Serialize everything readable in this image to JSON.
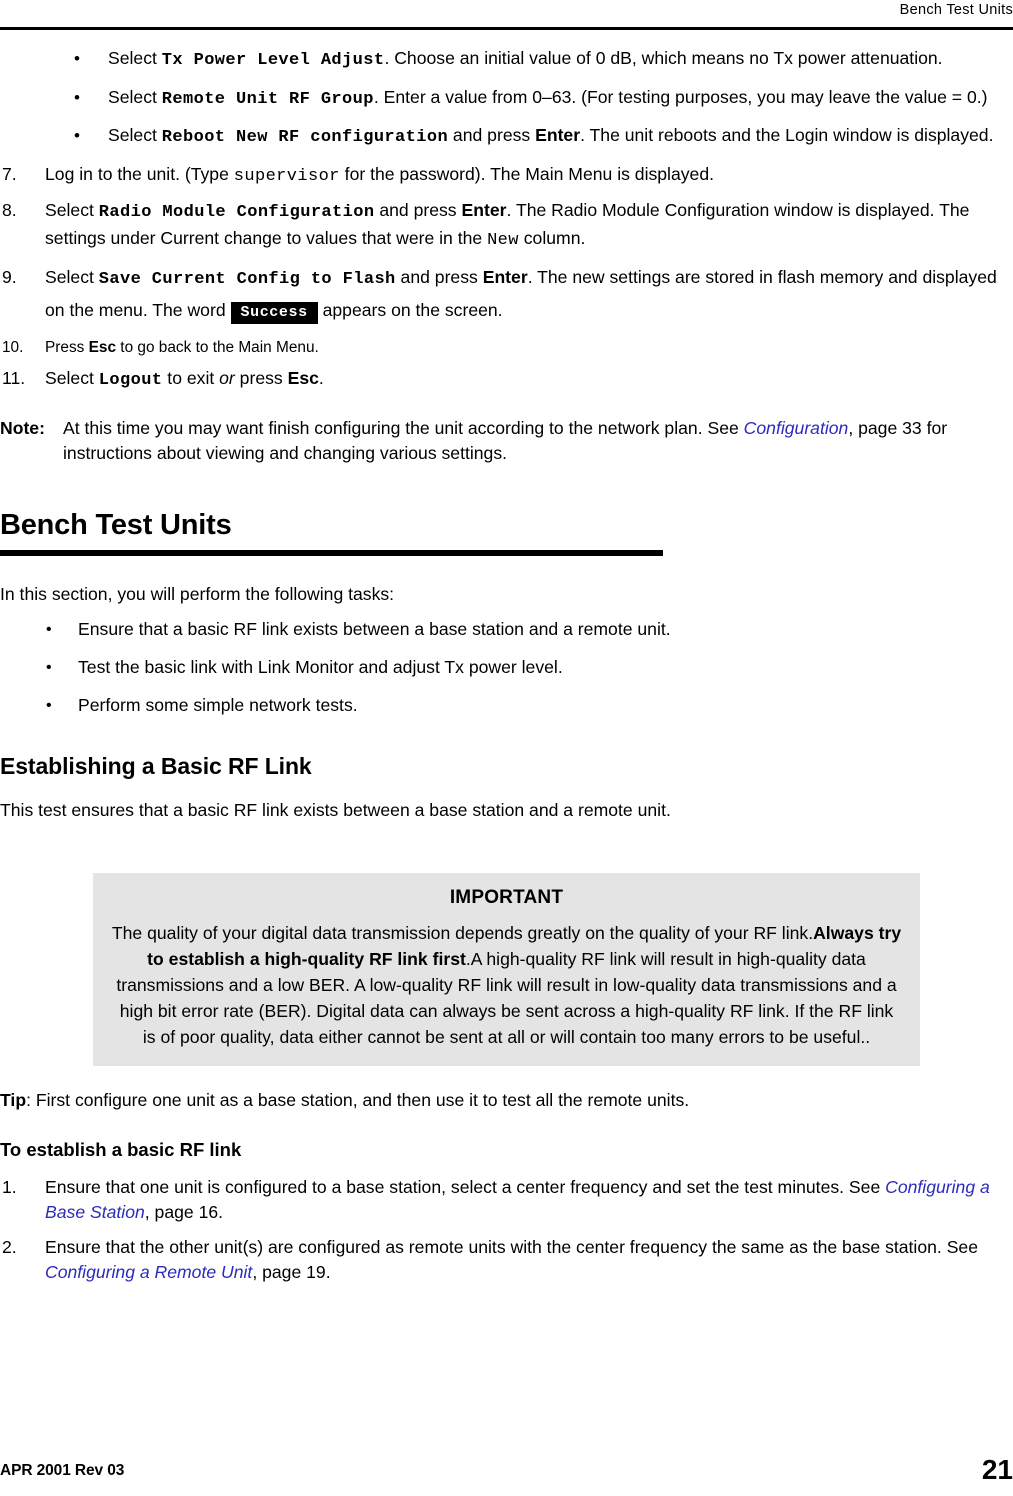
{
  "header": {
    "title": "Bench Test Units"
  },
  "sub_bullets": [
    {
      "bullet": "•",
      "lead": "Select ",
      "code": "Tx Power Level Adjust",
      "rest": ". Choose an initial value of 0 dB, which means no Tx power attenuation."
    },
    {
      "bullet": "•",
      "lead": "Select ",
      "code": "Remote Unit RF Group",
      "rest": ". Enter a value from 0–63. (For testing purposes, you may leave the value = 0.)"
    },
    {
      "bullet": "•",
      "lead": "Select ",
      "code": "Reboot New RF configuration",
      "mid": " and press ",
      "key": "Enter",
      "rest": ". The unit reboots and the Login window is displayed."
    }
  ],
  "steps": {
    "step7": {
      "num": "7.",
      "a": "Log in to the unit. (Type ",
      "mono": "supervisor",
      "b": " for the password). The Main Menu is displayed."
    },
    "step8": {
      "num": "8.",
      "a": "Select ",
      "code": "Radio Module Configuration",
      "b": " and press ",
      "key": "Enter",
      "c": ". The Radio Module Configuration window is displayed. The settings under Current change to values that were in the ",
      "mono": "New",
      "d": " column."
    },
    "step9": {
      "num": "9.",
      "a": "Select ",
      "code": "Save Current Config to Flash",
      "b": " and press ",
      "key": "Enter",
      "c": ". The new settings are stored in flash memory and displayed on the menu. The word ",
      "badge": "Success",
      "d": " appears on the screen."
    },
    "step10": {
      "num": "10.",
      "a": "Press ",
      "key": "Esc",
      "b": " to go back to the Main Menu."
    },
    "step11": {
      "num": "11.",
      "a": "Select ",
      "code": "Logout",
      "b": " to exit ",
      "em": "or",
      "c": " press ",
      "key": "Esc",
      "d": "."
    }
  },
  "note": {
    "label": "Note:",
    "a": "At this time you may want finish configuring the unit according to the network plan. See ",
    "xref": "Configuration",
    "b": ", page 33 for instructions about viewing and changing various settings."
  },
  "section": {
    "heading": "Bench Test Units",
    "intro": "In this section, you will perform the following tasks:",
    "tasks": [
      "Ensure that a basic RF link exists between a base station and a remote unit.",
      "Test the basic link with Link Monitor and adjust Tx power level.",
      "Perform some simple network tests."
    ]
  },
  "subsection": {
    "heading": "Establishing a Basic RF Link",
    "intro": "This test ensures that a basic RF link exists between a base station and a remote unit."
  },
  "callout": {
    "title": "IMPORTANT",
    "a": "The quality of your digital data transmission depends greatly on the quality of your RF link.",
    "bold": "Always try to establish a high-quality RF link first",
    "b": ".A high-quality RF link will result in high-quality data transmissions and a low BER. A low-quality RF link will result in low-quality data transmissions and a high bit error rate (BER). Digital data can always be sent across a high-quality RF link. If the RF link is of poor quality, data either cannot be sent at all or will contain too many errors to be useful.."
  },
  "tip": {
    "label": "Tip",
    "text": ": First configure one unit as a base station, and then use it to test all the remote units."
  },
  "procedure": {
    "heading": "To establish a basic RF link",
    "step1": {
      "num": "1.",
      "a": "Ensure that one unit is configured to a base station, select a center frequency and set the test minutes. See ",
      "xref": "Configuring a Base Station",
      "b": ", page 16."
    },
    "step2": {
      "num": "2.",
      "a": "Ensure that the other unit(s) are configured as remote units with the center frequency the same as the base station. See ",
      "xref": "Configuring a Remote Unit",
      "b": ", page 19."
    }
  },
  "footer": {
    "left": "APR 2001 Rev 03",
    "page": "21"
  },
  "colors": {
    "xref": "#2b2bbd",
    "callout_bg": "#e4e4e4",
    "rule": "#000000"
  }
}
